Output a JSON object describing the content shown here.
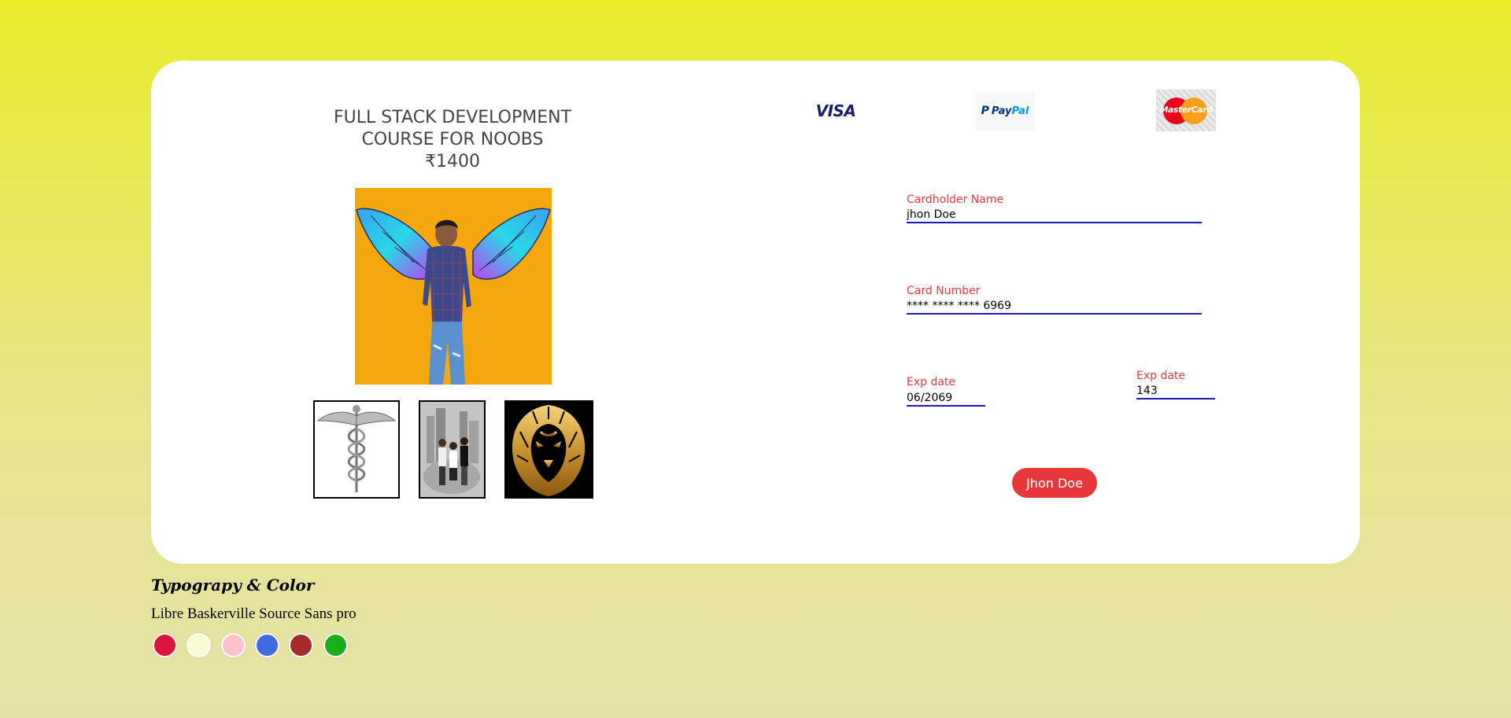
{
  "product": {
    "title": "FULL STACK DEVELOPMENT COURSE FOR NOOBS",
    "price": "₹1400",
    "thumbnails": [
      "caduceus-image",
      "group-photo-image",
      "golden-lion-image"
    ]
  },
  "payment_methods": {
    "visa": "VISA",
    "paypal_pay": "Pay",
    "paypal_pal": "Pal",
    "mastercard": "MasterCard"
  },
  "form": {
    "cardholder": {
      "label": "Cardholder Name",
      "value": "jhon Doe"
    },
    "card_number": {
      "label": "Card Number",
      "value": "**** **** **** 6969"
    },
    "exp_date": {
      "label": "Exp date",
      "value": "06/2069"
    },
    "cvv": {
      "label": "Exp date",
      "value": "143"
    },
    "submit_label": "Jhon Doe"
  },
  "style_guide": {
    "title": "Typograpy & Color",
    "fonts": "Libre Baskerville Source Sans pro",
    "colors": [
      "#dc143c",
      "#fafad2",
      "#ffc0cb",
      "#4169e1",
      "#a52a2a",
      "#1aaf1a"
    ]
  }
}
